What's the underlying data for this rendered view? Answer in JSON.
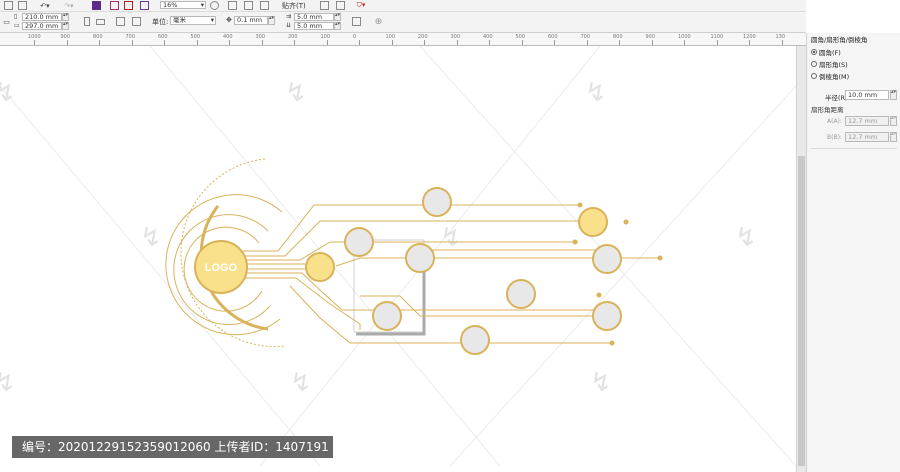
{
  "toolbar": {
    "zoom": "16%",
    "align_label": "贴齐(T)",
    "width": "210.0 mm",
    "height": "297.0 mm",
    "units_label": "单位:",
    "units_value": "毫米",
    "nudge": "0.1 mm",
    "dup_x": "5.0 mm",
    "dup_y": "5.0 mm"
  },
  "ruler": {
    "ticks": [
      "1000",
      "900",
      "800",
      "700",
      "600",
      "500",
      "400",
      "300",
      "200",
      "100",
      "0",
      "100",
      "200",
      "300",
      "400",
      "500",
      "600",
      "700",
      "800",
      "900",
      "1000",
      "1100",
      "1200",
      "130"
    ]
  },
  "canvas": {
    "logo_text": "LOGO",
    "watermark_glyph": "↯"
  },
  "panel": {
    "title": "圆角/扇形角/倒棱角",
    "opt_round": "圆角(F)",
    "opt_scallop": "扇形角(S)",
    "opt_chamfer": "倒棱角(M)",
    "radius_label": "半径(R):",
    "radius_value": "10.0 mm",
    "scallop_dist_label": "扇形角距离",
    "a_label": "A(A):",
    "a_value": "12.7 mm",
    "b_label": "B(B):",
    "b_value": "12.7 mm"
  },
  "watermark": {
    "text": "编号：20201229152359012060 上传者ID：1407191"
  },
  "colors": {
    "gold": "#d9b25a",
    "logo_fill": "#f8e18a",
    "node_gray": "#e8e8e8",
    "frame_gray": "#aaaaaa"
  }
}
